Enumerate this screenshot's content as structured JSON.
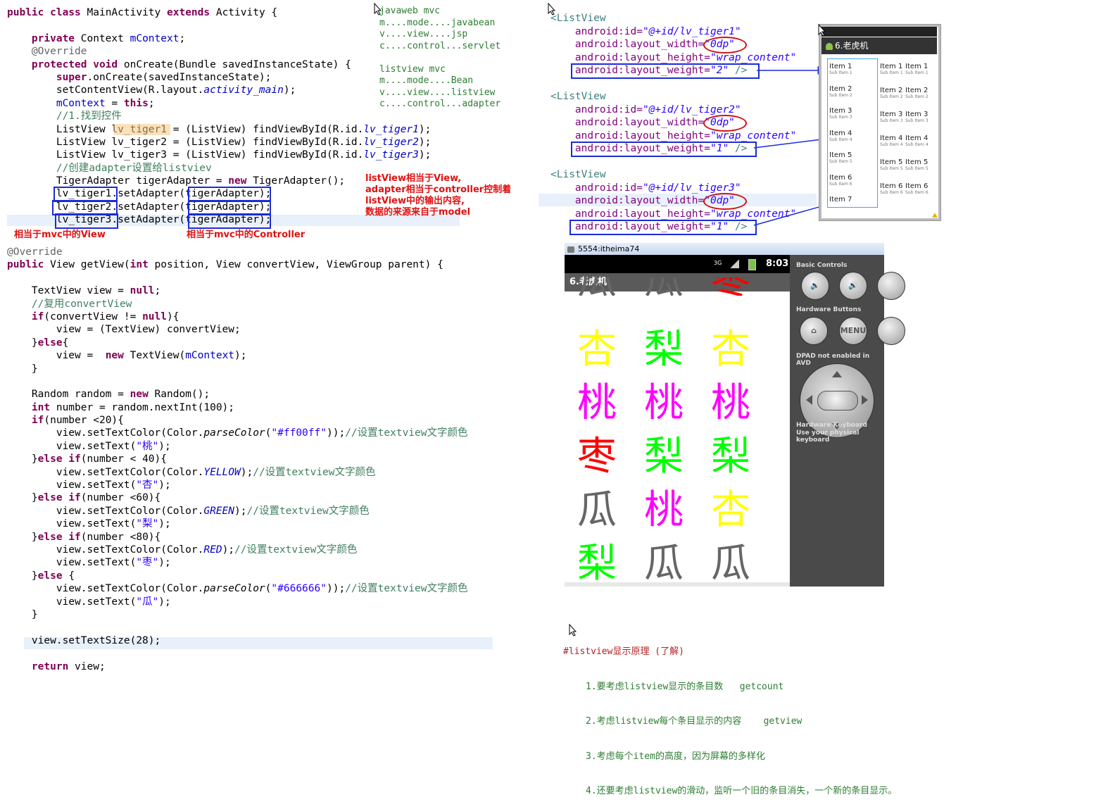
{
  "code_main": [
    [
      {
        "t": "public class ",
        "c": "kw"
      },
      {
        "t": "MainActivity "
      },
      {
        "t": "extends ",
        "c": "kw"
      },
      {
        "t": "Activity {"
      }
    ],
    [
      {
        "t": ""
      }
    ],
    [
      {
        "t": "    "
      },
      {
        "t": "private ",
        "c": "kw"
      },
      {
        "t": "Context "
      },
      {
        "t": "mContext",
        "c": "fld"
      },
      {
        "t": ";"
      }
    ],
    [
      {
        "t": "    "
      },
      {
        "t": "@Override",
        "c": "ann"
      }
    ],
    [
      {
        "t": "    "
      },
      {
        "t": "protected void ",
        "c": "kw"
      },
      {
        "t": "onCreate(Bundle savedInstanceState) {"
      }
    ],
    [
      {
        "t": "        "
      },
      {
        "t": "super",
        "c": "kw"
      },
      {
        "t": ".onCreate(savedInstanceState);"
      }
    ],
    [
      {
        "t": "        setContentView(R.layout."
      },
      {
        "t": "activity_main",
        "c": "it"
      },
      {
        "t": ");"
      }
    ],
    [
      {
        "t": "        "
      },
      {
        "t": "mContext",
        "c": "fld"
      },
      {
        "t": " = "
      },
      {
        "t": "this",
        "c": "kw"
      },
      {
        "t": ";"
      }
    ],
    [
      {
        "t": "        "
      },
      {
        "t": "//1.找到控件",
        "c": "cmt"
      }
    ],
    [
      {
        "t": "        ListView lv_tiger1 = (ListView) findViewById(R.id."
      },
      {
        "t": "lv_tiger1",
        "c": "it"
      },
      {
        "t": ");"
      }
    ],
    [
      {
        "t": "        ListView lv_tiger2 = (ListView) findViewById(R.id."
      },
      {
        "t": "lv_tiger2",
        "c": "it"
      },
      {
        "t": ");"
      }
    ],
    [
      {
        "t": "        ListView lv_tiger3 = (ListView) findViewById(R.id."
      },
      {
        "t": "lv_tiger3",
        "c": "it"
      },
      {
        "t": ");"
      }
    ],
    [
      {
        "t": "        "
      },
      {
        "t": "//创建adapter设置给listviev",
        "c": "cmt"
      }
    ],
    [
      {
        "t": "        TigerAdapter tigerAdapter = "
      },
      {
        "t": "new ",
        "c": "kw"
      },
      {
        "t": "TigerAdapter();"
      }
    ],
    [
      {
        "t": "        lv_tiger1.setAdapter(tigerAdapter);"
      }
    ],
    [
      {
        "t": "        lv_tiger2.setAdapter(tigerAdapter);"
      }
    ],
    [
      {
        "t": "        lv_tiger3.setAdapter(tigerAdapter);"
      }
    ]
  ],
  "code_getview": [
    [
      {
        "t": "@Override",
        "c": "ann"
      }
    ],
    [
      {
        "t": "public ",
        "c": "kw"
      },
      {
        "t": "View getView("
      },
      {
        "t": "int ",
        "c": "kw"
      },
      {
        "t": "position, View convertView, ViewGroup parent) {"
      }
    ],
    [
      {
        "t": ""
      }
    ],
    [
      {
        "t": "    TextView view = "
      },
      {
        "t": "null",
        "c": "kw"
      },
      {
        "t": ";"
      }
    ],
    [
      {
        "t": "    "
      },
      {
        "t": "//复用convertView",
        "c": "cmt"
      }
    ],
    [
      {
        "t": "    "
      },
      {
        "t": "if",
        "c": "kw"
      },
      {
        "t": "(convertView != "
      },
      {
        "t": "null",
        "c": "kw"
      },
      {
        "t": "){"
      }
    ],
    [
      {
        "t": "        view = (TextView) convertView;"
      }
    ],
    [
      {
        "t": "    }"
      },
      {
        "t": "else",
        "c": "kw"
      },
      {
        "t": "{"
      }
    ],
    [
      {
        "t": "        view =  "
      },
      {
        "t": "new ",
        "c": "kw"
      },
      {
        "t": "TextView("
      },
      {
        "t": "mContext",
        "c": "fld"
      },
      {
        "t": ");"
      }
    ],
    [
      {
        "t": "    }"
      }
    ],
    [
      {
        "t": ""
      }
    ],
    [
      {
        "t": "    Random random = "
      },
      {
        "t": "new ",
        "c": "kw"
      },
      {
        "t": "Random();"
      }
    ],
    [
      {
        "t": "    "
      },
      {
        "t": "int ",
        "c": "kw"
      },
      {
        "t": "number = random.nextInt(100);"
      }
    ],
    [
      {
        "t": "    "
      },
      {
        "t": "if",
        "c": "kw"
      },
      {
        "t": "(number <20){"
      }
    ],
    [
      {
        "t": "        view.setTextColor(Color."
      },
      {
        "t": "parseColor",
        "c": "it2"
      },
      {
        "t": "("
      },
      {
        "t": "\"#ff00ff\"",
        "c": "str"
      },
      {
        "t": "));"
      },
      {
        "t": "//设置textview文字颜色",
        "c": "cmt"
      }
    ],
    [
      {
        "t": "        view.setText("
      },
      {
        "t": "\"桃\"",
        "c": "str"
      },
      {
        "t": ");"
      }
    ],
    [
      {
        "t": "    }"
      },
      {
        "t": "else if",
        "c": "kw"
      },
      {
        "t": "(number < 40){"
      }
    ],
    [
      {
        "t": "        view.setTextColor(Color."
      },
      {
        "t": "YELLOW",
        "c": "it"
      },
      {
        "t": ");"
      },
      {
        "t": "//设置textview文字颜色",
        "c": "cmt"
      }
    ],
    [
      {
        "t": "        view.setText("
      },
      {
        "t": "\"杏\"",
        "c": "str"
      },
      {
        "t": ");"
      }
    ],
    [
      {
        "t": "    }"
      },
      {
        "t": "else if",
        "c": "kw"
      },
      {
        "t": "(number <60){"
      }
    ],
    [
      {
        "t": "        view.setTextColor(Color."
      },
      {
        "t": "GREEN",
        "c": "it"
      },
      {
        "t": ");"
      },
      {
        "t": "//设置textview文字颜色",
        "c": "cmt"
      }
    ],
    [
      {
        "t": "        view.setText("
      },
      {
        "t": "\"梨\"",
        "c": "str"
      },
      {
        "t": ");"
      }
    ],
    [
      {
        "t": "    }"
      },
      {
        "t": "else if",
        "c": "kw"
      },
      {
        "t": "(number <80){"
      }
    ],
    [
      {
        "t": "        view.setTextColor(Color."
      },
      {
        "t": "RED",
        "c": "it"
      },
      {
        "t": ");"
      },
      {
        "t": "//设置textview文字颜色",
        "c": "cmt"
      }
    ],
    [
      {
        "t": "        view.setText("
      },
      {
        "t": "\"枣\"",
        "c": "str"
      },
      {
        "t": ");"
      }
    ],
    [
      {
        "t": "    }"
      },
      {
        "t": "else ",
        "c": "kw"
      },
      {
        "t": "{"
      }
    ],
    [
      {
        "t": "        view.setTextColor(Color."
      },
      {
        "t": "parseColor",
        "c": "it2"
      },
      {
        "t": "("
      },
      {
        "t": "\"#666666\"",
        "c": "str"
      },
      {
        "t": "));"
      },
      {
        "t": "//设置textview文字颜色",
        "c": "cmt"
      }
    ],
    [
      {
        "t": "        view.setText("
      },
      {
        "t": "\"瓜\"",
        "c": "str"
      },
      {
        "t": ");"
      }
    ],
    [
      {
        "t": "    }"
      }
    ],
    [
      {
        "t": ""
      }
    ],
    [
      {
        "t": "    view.setTextSize(28);"
      }
    ],
    [
      {
        "t": ""
      }
    ],
    [
      {
        "t": "    "
      },
      {
        "t": "return ",
        "c": "kw"
      },
      {
        "t": "view;"
      }
    ]
  ],
  "notes": {
    "view_note": "相当于mvc中的View",
    "controller_note": "相当于mvc中的Controller",
    "explain": "listView相当于View,\nadapter相当于controller控制着\nlistView中的输出内容,\n数据的来源来自于model"
  },
  "mvc_text": "javaweb mvc\nm....mode....javabean\nv....view....jsp\nc....control...servlet\n\nlistview mvc\nm....mode....Bean\nv....view....listview\nc....control...adapter",
  "xml_blocks": [
    {
      "id": "lv_tiger1",
      "open": "<ListView",
      "id_attr": "android:id=",
      "id_val": "\"@+id/lv_tiger1\"",
      "w_attr": "android:layout_width=",
      "w_val": "\"0dp\"",
      "h_attr": "android:layout_height=",
      "h_val": "\"wrap_content\"",
      "wt_attr": "android:layout_weight=",
      "wt_val": "\"2\"",
      "close": " />"
    },
    {
      "id": "lv_tiger2",
      "open": "<ListView",
      "id_attr": "android:id=",
      "id_val": "\"@+id/lv_tiger2\"",
      "w_attr": "android:layout_width=",
      "w_val": "\"0dp\"",
      "h_attr": "android:layout_height=",
      "h_val": "\"wrap_content\"",
      "wt_attr": "android:layout_weight=",
      "wt_val": "\"1\"",
      "close": " />"
    },
    {
      "id": "lv_tiger3",
      "open": "<ListView",
      "id_attr": "android:id=",
      "id_val": "\"@+id/lv_tiger3\"",
      "w_attr": "android:layout_width=",
      "w_val": "\"0dp\"",
      "h_attr": "android:layout_height=",
      "h_val": "\"wrap_content\"",
      "wt_attr": "android:layout_weight=",
      "wt_val": "\"1\"",
      "close": " />"
    }
  ],
  "preview": {
    "title": "6.老虎机",
    "col1": [
      {
        "label": "Item 1",
        "sub": "Sub Item 1"
      },
      {
        "label": "Item 2",
        "sub": "Sub Item 2"
      },
      {
        "label": "Item 3",
        "sub": "Sub Item 3"
      },
      {
        "label": "Item 4",
        "sub": "Sub Item 4"
      },
      {
        "label": "Item 5",
        "sub": "Sub Item 5"
      },
      {
        "label": "Item 6",
        "sub": "Sub Item 6"
      },
      {
        "label": "Item 7",
        "sub": ""
      }
    ],
    "col2": [
      {
        "label": "Item 1",
        "sub": "Sub Item 1"
      },
      {
        "label": "Item 2",
        "sub": "Sub Item 2"
      },
      {
        "label": "Item 3",
        "sub": "Sub Item 3"
      },
      {
        "label": "Item 4",
        "sub": "Sub Item 4"
      },
      {
        "label": "Item 5",
        "sub": "Sub Item 5"
      },
      {
        "label": "Item 6",
        "sub": "Sub Item 6"
      }
    ],
    "col3": [
      {
        "label": "Item 1",
        "sub": "Sub Item 1"
      },
      {
        "label": "Item 2",
        "sub": "Sub Item 2"
      },
      {
        "label": "Item 3",
        "sub": "Sub Item 3"
      },
      {
        "label": "Item 4",
        "sub": "Sub Item 4"
      },
      {
        "label": "Item 5",
        "sub": "Sub Item 5"
      },
      {
        "label": "Item 6",
        "sub": "Sub Item 6"
      }
    ]
  },
  "emulator": {
    "window_title": "5554:itheima74",
    "time": "8:03",
    "network": "3G",
    "app_title": "6.老虎机",
    "columns": [
      [
        {
          "ch": "瓜",
          "color": "#666666"
        },
        {
          "ch": "杏",
          "color": "#ffff00"
        },
        {
          "ch": "桃",
          "color": "#ff00ff"
        },
        {
          "ch": "枣",
          "color": "#ff0000"
        },
        {
          "ch": "瓜",
          "color": "#666666"
        },
        {
          "ch": "梨",
          "color": "#00ff00"
        }
      ],
      [
        {
          "ch": "瓜",
          "color": "#666666"
        },
        {
          "ch": "梨",
          "color": "#00ff00"
        },
        {
          "ch": "桃",
          "color": "#ff00ff"
        },
        {
          "ch": "梨",
          "color": "#00ff00"
        },
        {
          "ch": "桃",
          "color": "#ff00ff"
        },
        {
          "ch": "瓜",
          "color": "#666666"
        }
      ],
      [
        {
          "ch": "枣",
          "color": "#ff0000"
        },
        {
          "ch": "杏",
          "color": "#ffff00"
        },
        {
          "ch": "桃",
          "color": "#ff00ff"
        },
        {
          "ch": "梨",
          "color": "#00ff00"
        },
        {
          "ch": "杏",
          "color": "#ffff00"
        },
        {
          "ch": "瓜",
          "color": "#666666"
        }
      ]
    ],
    "controls": {
      "basic": "Basic Controls",
      "hardware": "Hardware Buttons",
      "menu": "MENU",
      "dpad": "DPAD not enabled in AVD",
      "keyboard": "Hardware Keyboard",
      "keyboard_sub": "Use your physical keyboard"
    }
  },
  "bottom_note": {
    "title": "#listview显示原理 (了解)",
    "items": [
      "1.要考虑listview显示的条目数   getcount",
      "2.考虑listview每个条目显示的内容    getview",
      "3.考虑每个item的高度，因为屏幕的多样化",
      "4.还要考虑listview的滑动，监听一个旧的条目消失，一个新的条目显示。"
    ]
  }
}
